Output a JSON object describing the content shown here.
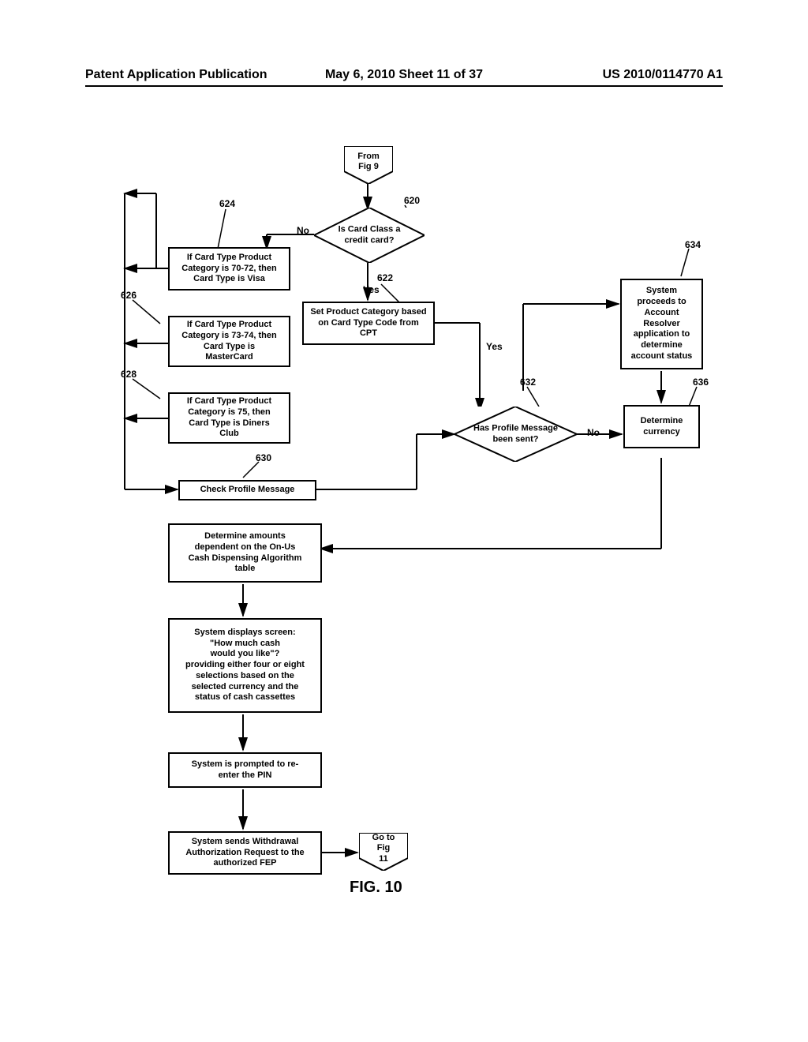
{
  "header": {
    "left": "Patent Application Publication",
    "center": "May 6, 2010  Sheet 11 of 37",
    "right": "US 2010/0114770 A1"
  },
  "offpage": {
    "from": "From\nFig 9",
    "to": "Go to\nFig 11"
  },
  "nodes": {
    "d620": "Is Card Class a\ncredit card?",
    "b622": "Set Product Category based\non Card Type Code from\nCPT",
    "b624": "If Card Type Product\nCategory is 70-72, then\nCard Type is Visa",
    "b626": "If Card Type Product\nCategory is 73-74, then\nCard Type is\nMasterCard",
    "b628": "If Card Type Product\nCategory is 75, then\nCard Type is Diners\nClub",
    "b630": "Check Profile Message",
    "d632": "Has Profile Message\nbeen sent?",
    "b634": "System\nproceeds to\nAccount\nResolver\napplication to\ndetermine\naccount status",
    "b636": "Determine\ncurrency",
    "b_amounts": "Determine amounts\ndependent on the On-Us\nCash Dispensing Algorithm\ntable",
    "b_screen": "System displays screen:\n\"How much cash\nwould you like\"?\nproviding either four or eight\nselections based on the\nselected currency and the\nstatus of cash cassettes",
    "b_pin": "System is prompted to re-\nenter the PIN",
    "b_withdraw": "System sends Withdrawal\nAuthorization Request to the\nauthorized FEP"
  },
  "edgeLabels": {
    "no620": "No",
    "yes620": "Yes",
    "yes632": "Yes",
    "no632": "No"
  },
  "refs": {
    "r620": "620",
    "r622": "622",
    "r624": "624",
    "r626": "626",
    "r628": "628",
    "r630": "630",
    "r632": "632",
    "r634": "634",
    "r636": "636"
  },
  "figure": "FIG. 10"
}
